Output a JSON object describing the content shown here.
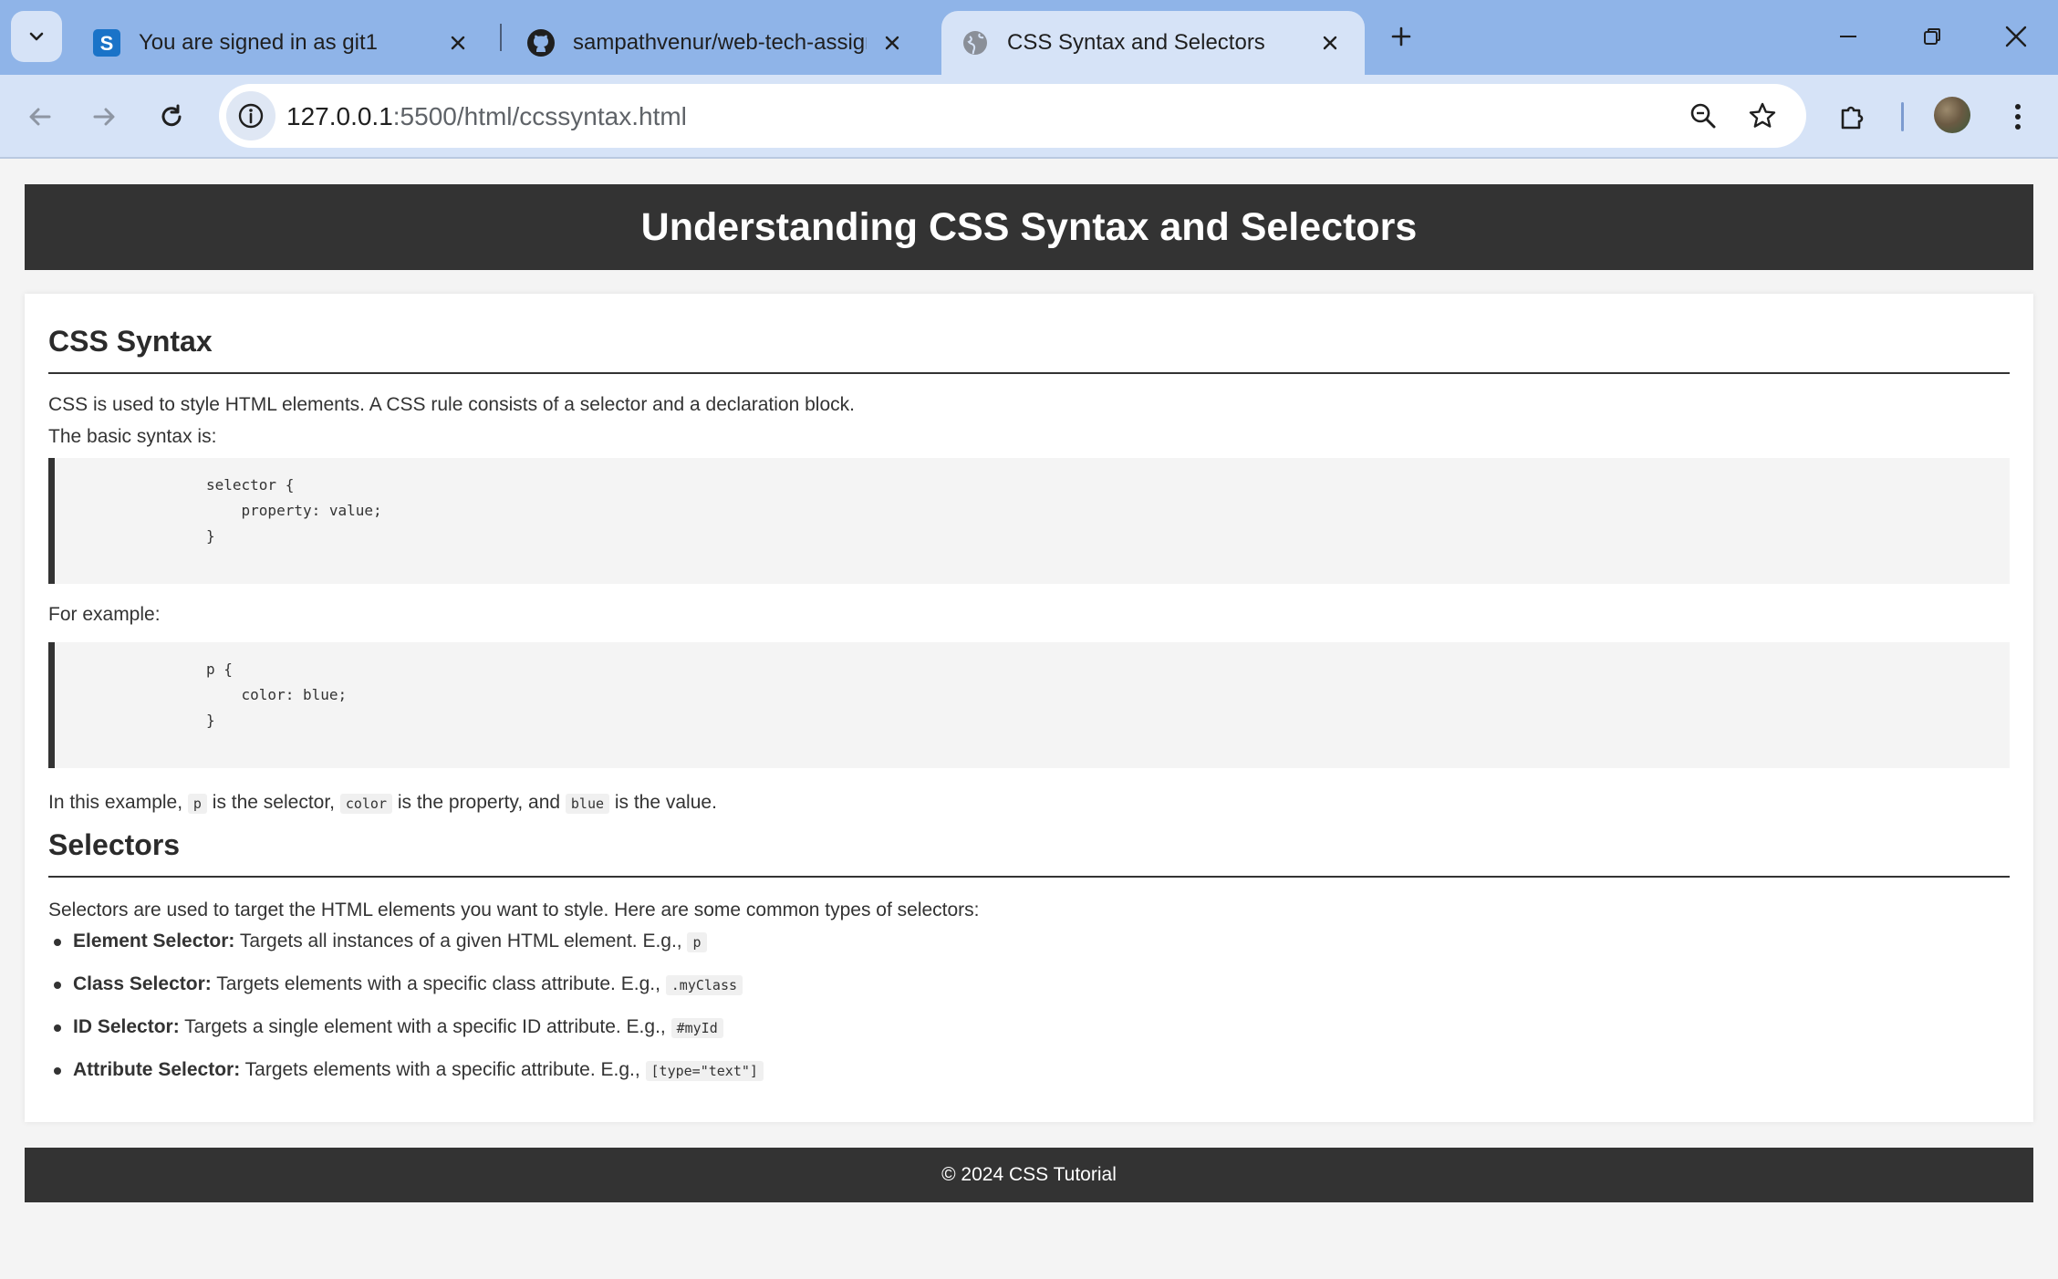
{
  "browser": {
    "tabs": [
      {
        "title": "You are signed in as git1",
        "favicon": "s-letter-icon",
        "active": false
      },
      {
        "title": "sampathvenur/web-tech-assign",
        "favicon": "github-icon",
        "active": false
      },
      {
        "title": "CSS Syntax and Selectors",
        "favicon": "globe-icon",
        "active": true
      }
    ],
    "address": {
      "host": "127.0.0.1",
      "rest": ":5500/html/ccssyntax.html"
    },
    "accent": "#8fb4e8",
    "toolbar_bg": "#d6e3f7"
  },
  "page": {
    "header_title": "Understanding CSS Syntax and Selectors",
    "syntax": {
      "title": "CSS Syntax",
      "intro1": "CSS is used to style HTML elements. A CSS rule consists of a selector and a declaration block.",
      "intro2": "The basic syntax is:",
      "code1": "selector {\n    property: value;\n}",
      "for_example": "For example:",
      "code2": "p {\n    color: blue;\n}",
      "explain": {
        "t1": "In this example, ",
        "c1": "p",
        "t2": " is the selector, ",
        "c2": "color",
        "t3": " is the property, and ",
        "c3": "blue",
        "t4": " is the value."
      }
    },
    "selectors": {
      "title": "Selectors",
      "intro": "Selectors are used to target the HTML elements you want to style. Here are some common types of selectors:",
      "items": [
        {
          "name": "Element Selector:",
          "desc": " Targets all instances of a given HTML element. E.g., ",
          "example": "p"
        },
        {
          "name": "Class Selector:",
          "desc": " Targets elements with a specific class attribute. E.g., ",
          "example": ".myClass"
        },
        {
          "name": "ID Selector:",
          "desc": " Targets a single element with a specific ID attribute. E.g., ",
          "example": "#myId"
        },
        {
          "name": "Attribute Selector:",
          "desc": " Targets elements with a specific attribute. E.g., ",
          "example": "[type=\"text\"]"
        }
      ]
    },
    "footer": "© 2024 CSS Tutorial",
    "colors": {
      "header_bg": "#333333",
      "page_bg": "#f4f4f4",
      "code_bg": "#f4f4f4"
    }
  }
}
